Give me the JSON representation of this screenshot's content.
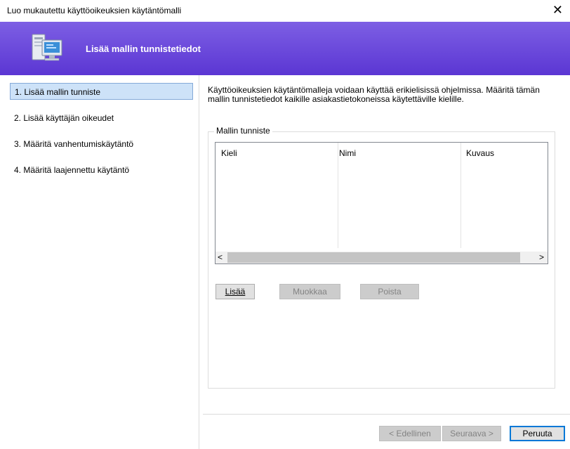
{
  "window": {
    "title": "Luo mukautettu käyttöoikeuksien käytäntömalli",
    "close_glyph": "✕"
  },
  "banner": {
    "heading": "Lisää mallin tunnistetiedot",
    "background_color": "#6a49dc",
    "icon": "computer-setup-icon"
  },
  "steps": [
    "1. Lisää mallin tunniste",
    "2. Lisää käyttäjän oikeudet",
    "3. Määritä vanhentumiskäytäntö",
    "4. Määritä laajennettu käytäntö"
  ],
  "intro": "Käyttöoikeuksien käytäntömalleja voidaan käyttää erikielisissä ohjelmissa. Määritä tämän mallin tunnistetiedot kaikille asiakastietokoneissa käytettäville kielille.",
  "groupbox": {
    "label": "Mallin tunniste",
    "columns": [
      "Kieli",
      "Nimi",
      "Kuvaus"
    ],
    "scroll_left": "<",
    "scroll_right": ">",
    "buttons": {
      "add": "Lisää",
      "edit": "Muokkaa",
      "delete": "Poista"
    }
  },
  "footer": {
    "back": "< Edellinen",
    "next": "Seuraava >",
    "cancel": "Peruuta"
  }
}
